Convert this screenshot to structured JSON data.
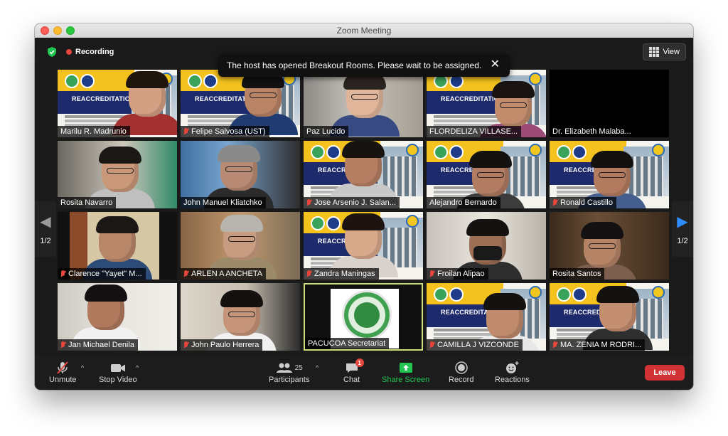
{
  "window": {
    "title": "Zoom Meeting"
  },
  "meeting": {
    "recording_label": "Recording",
    "view_label": "View",
    "notification": "The host has opened Breakout Rooms. Please wait to be assigned.",
    "page_indicator_left": "1/2",
    "page_indicator_right": "1/2"
  },
  "tiles": [
    {
      "name": "Marilu R. Madrunio",
      "muted": false
    },
    {
      "name": "Felipe Salvosa (UST)",
      "muted": true
    },
    {
      "name": "Paz Lucido",
      "muted": false
    },
    {
      "name": "FLORDELIZA VILLASE...",
      "muted": false
    },
    {
      "name": "Dr. Elizabeth Malaba...",
      "muted": false
    },
    {
      "name": "Rosita Navarro",
      "muted": false
    },
    {
      "name": "John Manuel Kliatchko",
      "muted": false
    },
    {
      "name": "Jose Arsenio J. Salan...",
      "muted": true
    },
    {
      "name": "Alejandro Bernardo",
      "muted": false
    },
    {
      "name": "Ronald Castillo",
      "muted": true
    },
    {
      "name": "Clarence \"Yayet\" M...",
      "muted": true
    },
    {
      "name": "ARLEN A ANCHETA",
      "muted": true
    },
    {
      "name": "Zandra Maningas",
      "muted": true
    },
    {
      "name": "Froilan Alipao",
      "muted": true
    },
    {
      "name": "Rosita Santos",
      "muted": false
    },
    {
      "name": "Jan Michael Denila",
      "muted": true
    },
    {
      "name": "John Paulo Herrera",
      "muted": true
    },
    {
      "name": "PACUCOA Secretariat",
      "muted": false
    },
    {
      "name": "CAMILLA J VIZCONDE",
      "muted": true
    },
    {
      "name": "MA. ZENIA M RODRI...",
      "muted": true
    }
  ],
  "slide_text": "REACCREDITATION",
  "toolbar": {
    "unmute_label": "Unmute",
    "stop_video_label": "Stop Video",
    "participants_label": "Participants",
    "participants_count": "25",
    "chat_label": "Chat",
    "chat_badge": "1",
    "share_screen_label": "Share Screen",
    "record_label": "Record",
    "reactions_label": "Reactions",
    "leave_label": "Leave"
  },
  "colors": {
    "recording": "#e8453c",
    "share_screen": "#23c552",
    "leave": "#d03236",
    "active_speaker_border": "#c9e07a"
  }
}
